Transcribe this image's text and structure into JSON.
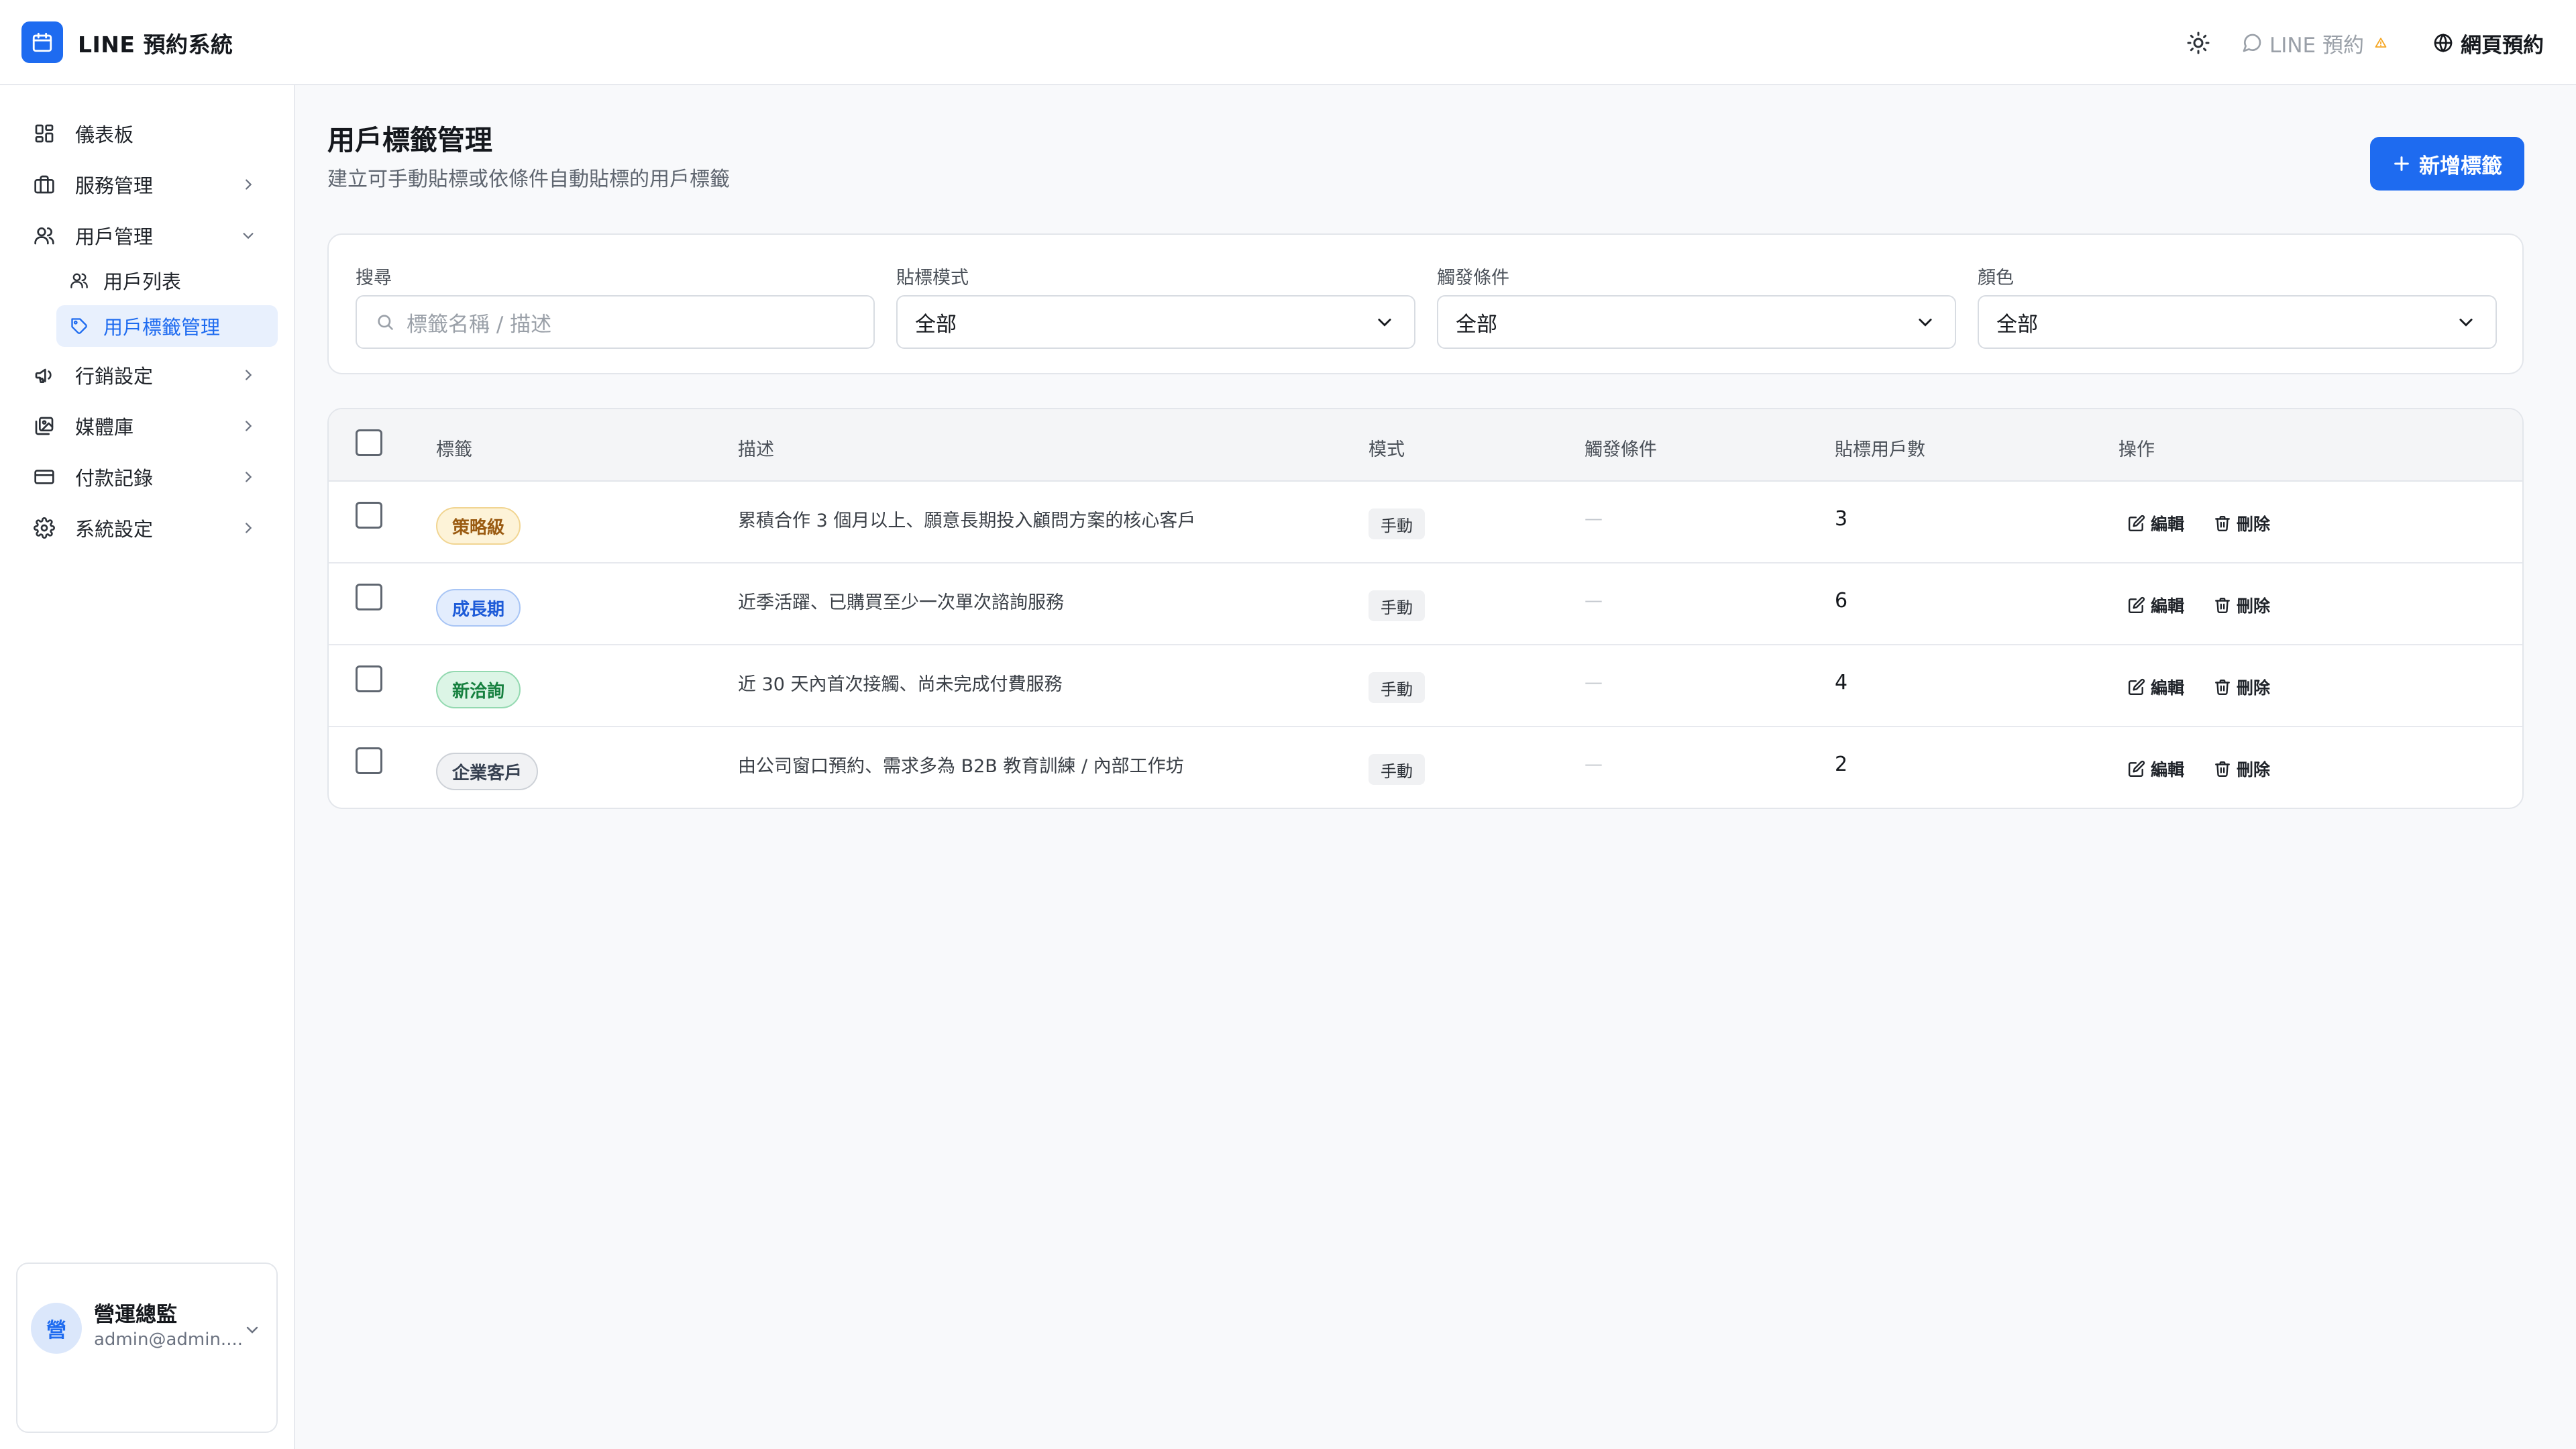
{
  "app": {
    "title": "LINE 預約系統"
  },
  "topbar": {
    "line_link": "LINE 預約",
    "web_link": "網頁預約"
  },
  "sidebar": {
    "items": [
      {
        "label": "儀表板",
        "icon": "dashboard-icon"
      },
      {
        "label": "服務管理",
        "icon": "briefcase-icon"
      },
      {
        "label": "用戶管理",
        "icon": "users-icon"
      },
      {
        "label": "行銷設定",
        "icon": "megaphone-icon"
      },
      {
        "label": "媒體庫",
        "icon": "images-icon"
      },
      {
        "label": "付款記錄",
        "icon": "credit-card-icon"
      },
      {
        "label": "系統設定",
        "icon": "gear-icon"
      }
    ],
    "sub_items": [
      {
        "label": "用戶列表",
        "icon": "users-icon"
      },
      {
        "label": "用戶標籤管理",
        "icon": "tag-icon",
        "active": true
      }
    ],
    "user": {
      "avatar": "營",
      "name": "營運總監",
      "email": "admin@admin...."
    }
  },
  "page": {
    "title": "用戶標籤管理",
    "subtitle": "建立可手動貼標或依條件自動貼標的用戶標籤",
    "add_button": "新增標籤"
  },
  "filters": {
    "search": {
      "label": "搜尋",
      "placeholder": "標籤名稱 / 描述"
    },
    "mode": {
      "label": "貼標模式",
      "value": "全部"
    },
    "trigger": {
      "label": "觸發條件",
      "value": "全部"
    },
    "color": {
      "label": "顏色",
      "value": "全部"
    }
  },
  "table": {
    "headers": [
      "標籤",
      "描述",
      "模式",
      "觸發條件",
      "貼標用戶數",
      "操作"
    ],
    "rows": [
      {
        "tag": "策略級",
        "color": "#b7791f",
        "desc": "累積合作 3 個月以上、願意長期投入顧問方案的核心客戶",
        "mode": "手動",
        "trigger": "—",
        "count": "3"
      },
      {
        "tag": "成長期",
        "color": "#2563eb",
        "desc": "近季活躍、已購買至少一次單次諮詢服務",
        "mode": "手動",
        "trigger": "—",
        "count": "6"
      },
      {
        "tag": "新洽詢",
        "color": "#15803d",
        "desc": "近 30 天內首次接觸、尚未完成付費服務",
        "mode": "手動",
        "trigger": "—",
        "count": "4"
      },
      {
        "tag": "企業客戶",
        "color": "#4b5563",
        "desc": "由公司窗口預約、需求多為 B2B 教育訓練 / 內部工作坊",
        "mode": "手動",
        "trigger": "—",
        "count": "2"
      }
    ],
    "actions": {
      "edit": "編輯",
      "delete": "刪除"
    }
  },
  "colors": {
    "accent": "#1e6bf0",
    "tag_strategy_bg": "#fdf3d8",
    "tag_growth_bg": "#e3edfd",
    "tag_new_bg": "#dcf5e6",
    "tag_enterprise_bg": "#f1f2f4",
    "warning": "#f5a623"
  }
}
